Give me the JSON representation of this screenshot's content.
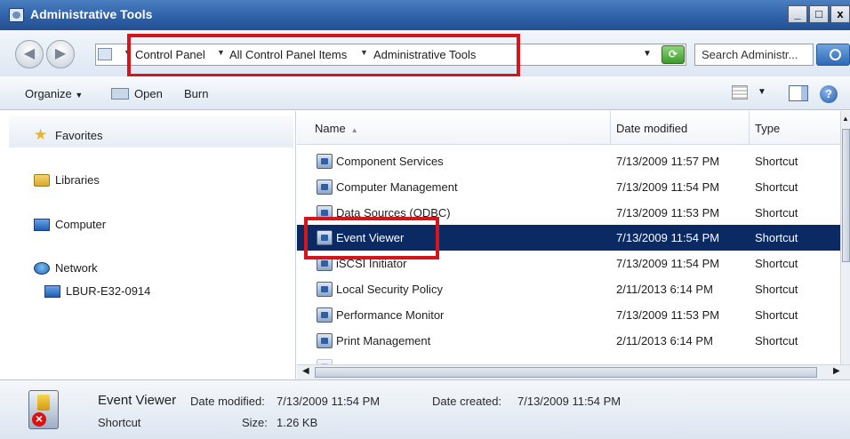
{
  "window": {
    "title": "Administrative Tools",
    "controls": [
      "_",
      "□",
      "x"
    ]
  },
  "address_bar": {
    "breadcrumbs": [
      "Control Panel",
      "All Control Panel Items",
      "Administrative Tools"
    ],
    "search_placeholder": "Search Administr..."
  },
  "toolbar": {
    "organize": "Organize",
    "open": "Open",
    "burn": "Burn"
  },
  "navigation": {
    "favorites": "Favorites",
    "libraries": "Libraries",
    "computer": "Computer",
    "network": "Network",
    "network_child": "LBUR-E32-0914"
  },
  "columns": {
    "name": "Name",
    "date_modified": "Date modified",
    "type": "Type"
  },
  "files": [
    {
      "name": "Component Services",
      "date": "7/13/2009 11:57 PM",
      "type": "Shortcut"
    },
    {
      "name": "Computer Management",
      "date": "7/13/2009 11:54 PM",
      "type": "Shortcut"
    },
    {
      "name": "Data Sources (ODBC)",
      "date": "7/13/2009 11:53 PM",
      "type": "Shortcut"
    },
    {
      "name": "Event Viewer",
      "date": "7/13/2009 11:54 PM",
      "type": "Shortcut"
    },
    {
      "name": "iSCSI Initiator",
      "date": "7/13/2009 11:54 PM",
      "type": "Shortcut"
    },
    {
      "name": "Local Security Policy",
      "date": "2/11/2013 6:14 PM",
      "type": "Shortcut"
    },
    {
      "name": "Performance Monitor",
      "date": "7/13/2009 11:53 PM",
      "type": "Shortcut"
    },
    {
      "name": "Print Management",
      "date": "2/11/2013 6:14 PM",
      "type": "Shortcut"
    }
  ],
  "details": {
    "name": "Event Viewer",
    "date_modified_label": "Date modified:",
    "date_modified": "7/13/2009 11:54 PM",
    "date_created_label": "Date created:",
    "date_created": "7/13/2009 11:54 PM",
    "kind": "Shortcut",
    "size_label": "Size:",
    "size": "1.26 KB"
  },
  "colors": {
    "selection": "#0b2a64",
    "highlight_box": "#d6141b",
    "titlebar": "#2d5fa6"
  }
}
